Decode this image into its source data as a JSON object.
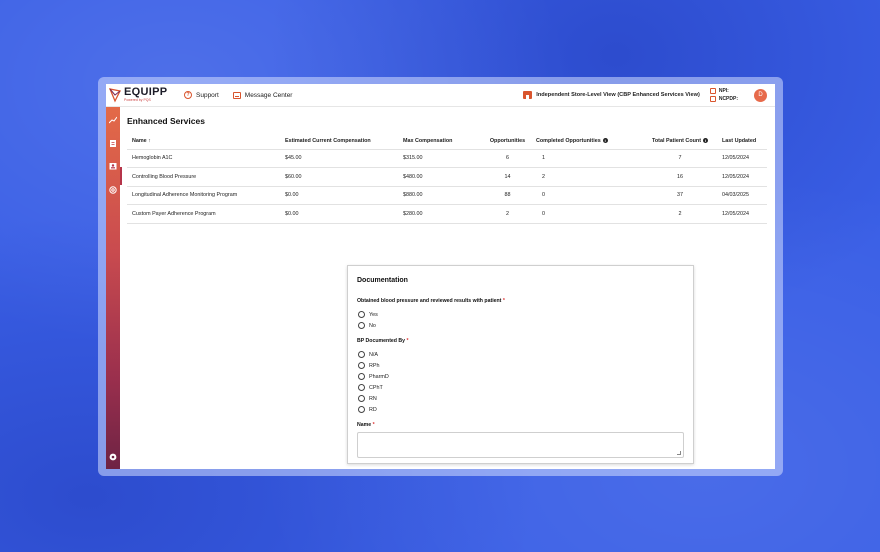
{
  "app": {
    "logo_word": "EQUIPP",
    "logo_sub": "Powered by PQS",
    "accent": "#d9552e"
  },
  "topbar": {
    "support_label": "Support",
    "message_center_label": "Message Center",
    "store_view_label": "Independent Store-Level View (CBP Enhanced Services View)",
    "npi_label": "NPI:",
    "ncpdp_label": "NCPDP:",
    "avatar_initial": "D"
  },
  "sidebar": {
    "icons": [
      "trend-chart-icon",
      "clipboard-icon",
      "id-card-icon",
      "at-sign-icon",
      "settings-icon"
    ]
  },
  "main": {
    "title": "Enhanced Services",
    "columns": [
      "Name ↑",
      "Estimated Current Compensation",
      "Max Compensation",
      "Opportunities",
      "Completed Opportunities",
      "Total Patient Count",
      "Last Updated"
    ],
    "rows": [
      [
        "Hemoglobin A1C",
        "$45.00",
        "$315.00",
        "6",
        "1",
        "7",
        "12/05/2024"
      ],
      [
        "Controlling Blood Pressure",
        "$60.00",
        "$480.00",
        "14",
        "2",
        "16",
        "12/05/2024"
      ],
      [
        "Longitudinal Adherence Monitoring Program",
        "$0.00",
        "$880.00",
        "88",
        "0",
        "37",
        "04/03/2025"
      ],
      [
        "Custom Payer Adherence Program",
        "$0.00",
        "$280.00",
        "2",
        "0",
        "2",
        "12/05/2024"
      ]
    ]
  },
  "documentation": {
    "title": "Documentation",
    "q1": "Obtained blood pressure and reviewed results with patient",
    "q1_options": [
      "Yes",
      "No"
    ],
    "q2": "BP Documented By",
    "q2_options": [
      "N/A",
      "RPh",
      "PharmD",
      "CPhT",
      "RN",
      "RD"
    ],
    "q3": "Name",
    "required_mark": "*"
  }
}
